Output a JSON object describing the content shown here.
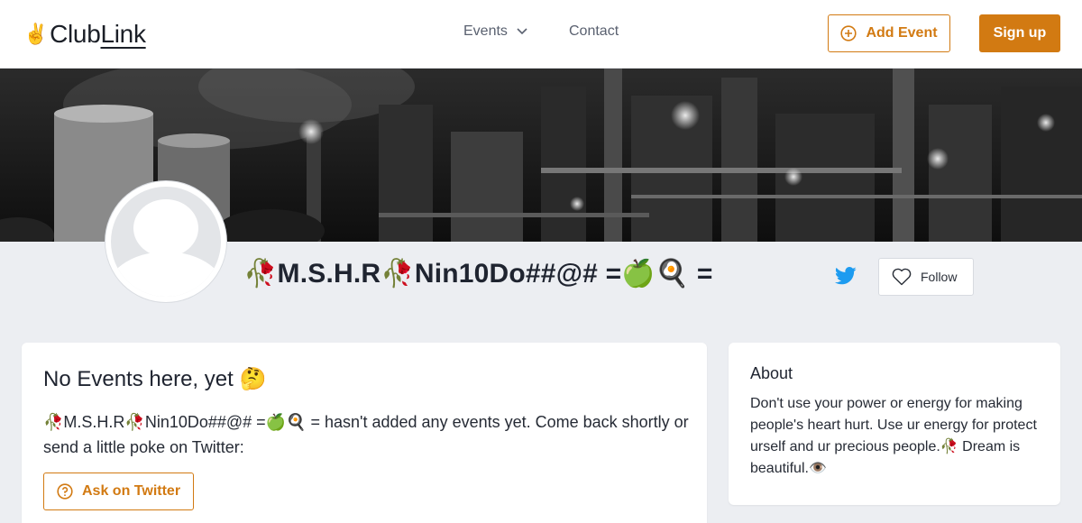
{
  "header": {
    "logo_hand": "✌️",
    "logo_club": "Club",
    "logo_link": "Link",
    "nav_events": "Events",
    "nav_contact": "Contact",
    "add_event_label": "Add Event",
    "signup_label": "Sign up"
  },
  "profile": {
    "name": "🥀M.S.H.R🥀Nin10Do##@#  =🍏🍳 =",
    "follow_label": "Follow"
  },
  "events_card": {
    "heading": "No Events here, yet 🤔",
    "message": "🥀M.S.H.R🥀Nin10Do##@#  =🍏🍳 =  hasn't added any events yet. Come back shortly or send a little poke on Twitter:",
    "ask_label": "Ask on Twitter"
  },
  "about_card": {
    "title": "About",
    "text": "Don't use your power or energy for making people's heart hurt. Use ur energy for protect urself and ur precious people.🥀 Dream is beautiful.👁️"
  },
  "colors": {
    "accent": "#d27a12",
    "twitter": "#1d9bf0",
    "page_bg": "#eceef2"
  },
  "icons": [
    "chevron-down-icon",
    "plus-circle-icon",
    "twitter-icon",
    "heart-icon",
    "question-circle-icon"
  ]
}
